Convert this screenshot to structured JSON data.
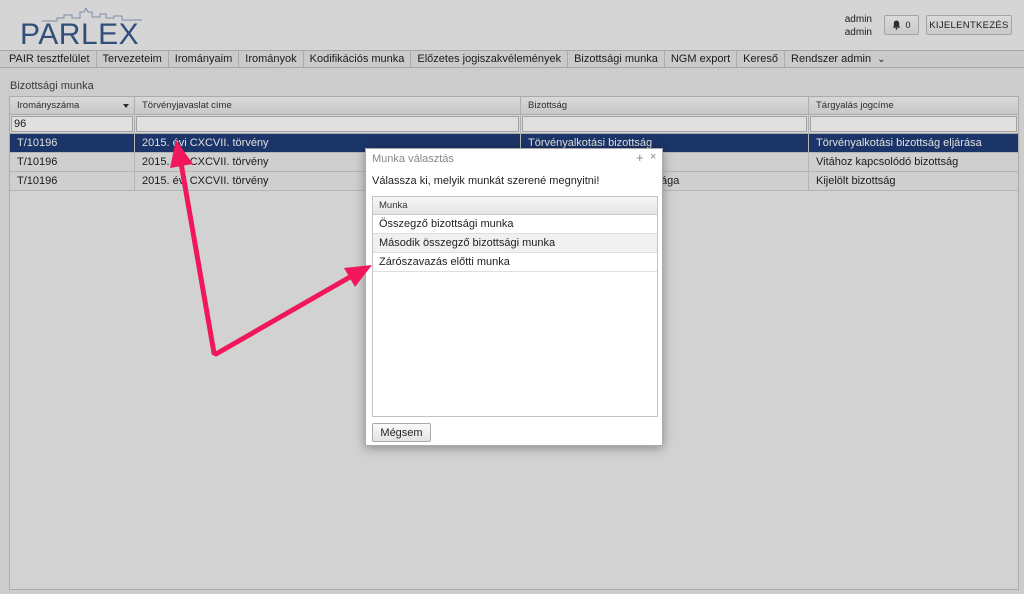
{
  "header": {
    "logo": "PARLEX",
    "user_line1": "admin",
    "user_line2": "admin",
    "notification_count": "0",
    "logout_label": "KIJELENTKEZÉS",
    "icons": {
      "bell": "bell-icon"
    }
  },
  "nav": {
    "items": [
      "PAIR tesztfelület",
      "Tervezeteim",
      "Irományaim",
      "Irományok",
      "Kodifikációs munka",
      "Előzetes jogiszakvélemények",
      "Bizottsági munka",
      "NGM export",
      "Kereső",
      "Rendszer admin"
    ],
    "dropdown_caret": "⌄"
  },
  "page": {
    "title": "Bizottsági munka"
  },
  "grid": {
    "columns": [
      "Irományszáma",
      "Törvényjavaslat címe",
      "Bizottság",
      "Tárgyalás jogcíme"
    ],
    "filter_value": "96",
    "rows": [
      [
        "T/10196",
        "2015. évi CXCVII. törvény",
        "Törvényalkotási bizottság",
        "Törvényalkotási bizottság eljárása"
      ],
      [
        "T/10196",
        "2015. évi CXCVII. törvény",
        "",
        "Vitához kapcsolódó bizottság"
      ],
      [
        "T/10196",
        "2015. évi CXCVII. törvény",
        "ága",
        "Kijelölt bizottság"
      ]
    ]
  },
  "dialog": {
    "title": "Munka választás",
    "plus": "+",
    "close": "×",
    "prompt": "Válassza ki, melyik munkát szerené megnyitni!",
    "list_header": "Munka",
    "items": [
      "Összegző bizottsági munka",
      "Második összegző bizottsági munka",
      "Zárószavazás előtti munka"
    ],
    "cancel_label": "Mégsem"
  },
  "colors": {
    "brand": "#3a5a8c",
    "selected_row": "#1f3d78",
    "annotation_arrow": "#f0185a"
  }
}
